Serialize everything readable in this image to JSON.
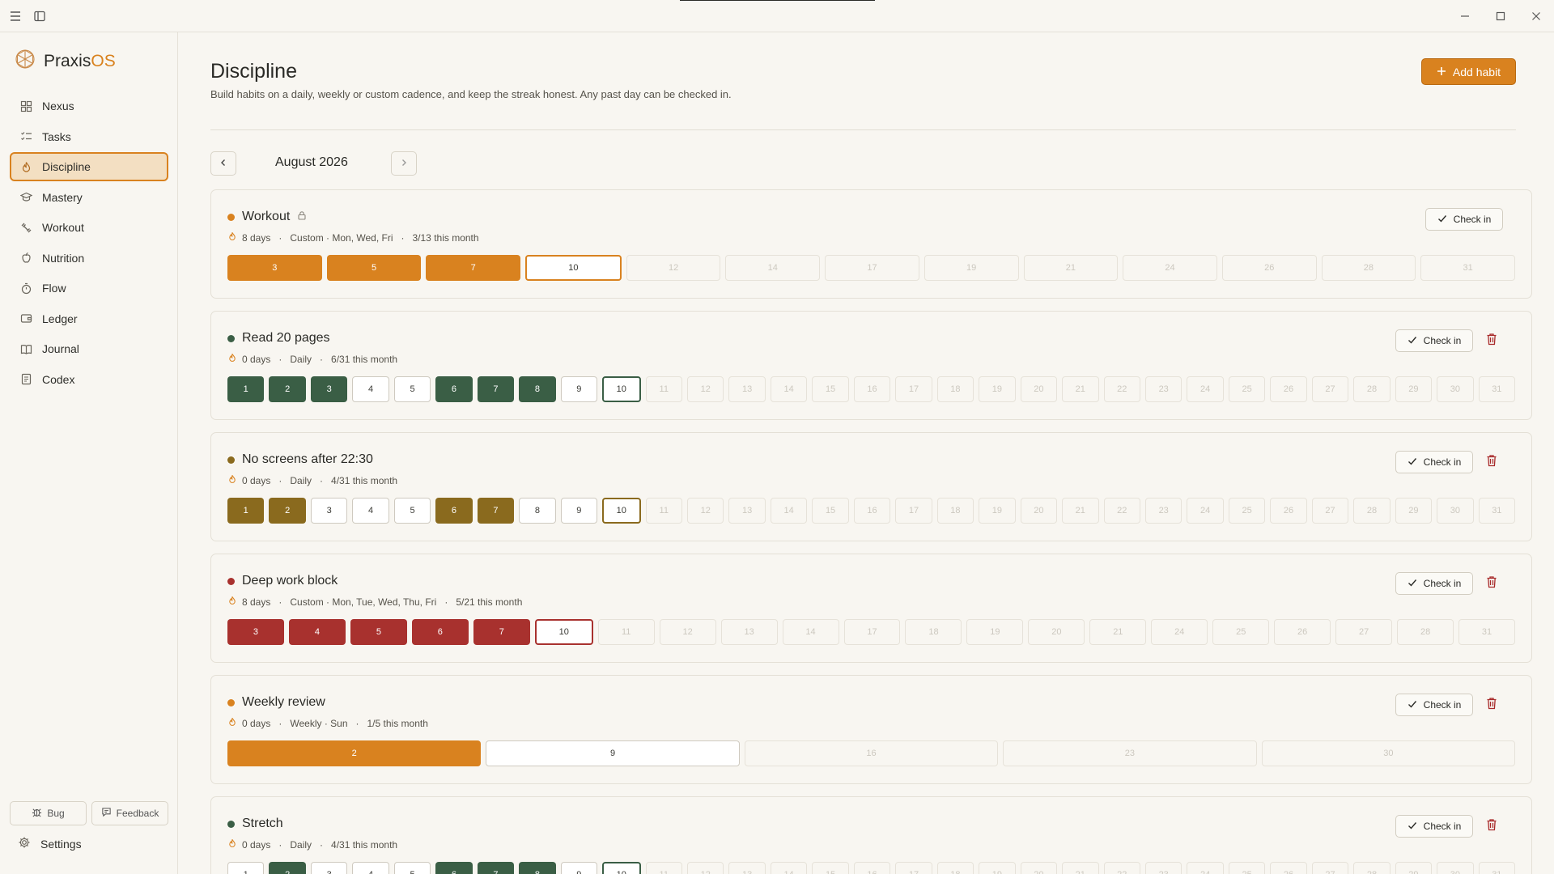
{
  "app": {
    "brand_main": "Praxis",
    "brand_accent": "OS",
    "accent_color": "#d9821f"
  },
  "sidebar": {
    "items": [
      {
        "label": "Nexus",
        "icon": "grid-icon",
        "active": false
      },
      {
        "label": "Tasks",
        "icon": "list-check-icon",
        "active": false
      },
      {
        "label": "Discipline",
        "icon": "flame-icon",
        "active": true
      },
      {
        "label": "Mastery",
        "icon": "graduation-cap-icon",
        "active": false
      },
      {
        "label": "Workout",
        "icon": "dumbbell-icon",
        "active": false
      },
      {
        "label": "Nutrition",
        "icon": "apple-icon",
        "active": false
      },
      {
        "label": "Flow",
        "icon": "timer-icon",
        "active": false
      },
      {
        "label": "Ledger",
        "icon": "wallet-icon",
        "active": false
      },
      {
        "label": "Journal",
        "icon": "book-icon",
        "active": false
      },
      {
        "label": "Codex",
        "icon": "scroll-icon",
        "active": false
      }
    ],
    "bug_label": "Bug",
    "feedback_label": "Feedback",
    "settings_label": "Settings"
  },
  "page": {
    "title": "Discipline",
    "description": "Build habits on a daily, weekly or custom cadence, and keep the streak honest. Any past day can be checked in.",
    "add_habit_label": "Add habit",
    "month_label": "August 2026"
  },
  "check_in_label": "Check in",
  "habits": [
    {
      "name": "Workout",
      "color": "#d9821f",
      "locked": true,
      "deletable": false,
      "streak": "8 days",
      "cadence": "Custom · Mon, Wed, Fri",
      "progress": "3/13 this month",
      "days": [
        {
          "n": "3",
          "s": "done"
        },
        {
          "n": "5",
          "s": "done"
        },
        {
          "n": "7",
          "s": "done"
        },
        {
          "n": "10",
          "s": "today"
        },
        {
          "n": "12",
          "s": "future"
        },
        {
          "n": "14",
          "s": "future"
        },
        {
          "n": "17",
          "s": "future"
        },
        {
          "n": "19",
          "s": "future"
        },
        {
          "n": "21",
          "s": "future"
        },
        {
          "n": "24",
          "s": "future"
        },
        {
          "n": "26",
          "s": "future"
        },
        {
          "n": "28",
          "s": "future"
        },
        {
          "n": "31",
          "s": "future"
        }
      ]
    },
    {
      "name": "Read 20 pages",
      "color": "#3a5e45",
      "locked": false,
      "deletable": true,
      "streak": "0 days",
      "cadence": "Daily",
      "progress": "6/31 this month",
      "days": [
        {
          "n": "1",
          "s": "done"
        },
        {
          "n": "2",
          "s": "done"
        },
        {
          "n": "3",
          "s": "done"
        },
        {
          "n": "4",
          "s": "past"
        },
        {
          "n": "5",
          "s": "past"
        },
        {
          "n": "6",
          "s": "done"
        },
        {
          "n": "7",
          "s": "done"
        },
        {
          "n": "8",
          "s": "done"
        },
        {
          "n": "9",
          "s": "past"
        },
        {
          "n": "10",
          "s": "today"
        },
        {
          "n": "11",
          "s": "future"
        },
        {
          "n": "12",
          "s": "future"
        },
        {
          "n": "13",
          "s": "future"
        },
        {
          "n": "14",
          "s": "future"
        },
        {
          "n": "15",
          "s": "future"
        },
        {
          "n": "16",
          "s": "future"
        },
        {
          "n": "17",
          "s": "future"
        },
        {
          "n": "18",
          "s": "future"
        },
        {
          "n": "19",
          "s": "future"
        },
        {
          "n": "20",
          "s": "future"
        },
        {
          "n": "21",
          "s": "future"
        },
        {
          "n": "22",
          "s": "future"
        },
        {
          "n": "23",
          "s": "future"
        },
        {
          "n": "24",
          "s": "future"
        },
        {
          "n": "25",
          "s": "future"
        },
        {
          "n": "26",
          "s": "future"
        },
        {
          "n": "27",
          "s": "future"
        },
        {
          "n": "28",
          "s": "future"
        },
        {
          "n": "29",
          "s": "future"
        },
        {
          "n": "30",
          "s": "future"
        },
        {
          "n": "31",
          "s": "future"
        }
      ]
    },
    {
      "name": "No screens after 22:30",
      "color": "#8a6a1e",
      "locked": false,
      "deletable": true,
      "streak": "0 days",
      "cadence": "Daily",
      "progress": "4/31 this month",
      "days": [
        {
          "n": "1",
          "s": "done"
        },
        {
          "n": "2",
          "s": "done"
        },
        {
          "n": "3",
          "s": "past"
        },
        {
          "n": "4",
          "s": "past"
        },
        {
          "n": "5",
          "s": "past"
        },
        {
          "n": "6",
          "s": "done"
        },
        {
          "n": "7",
          "s": "done"
        },
        {
          "n": "8",
          "s": "past"
        },
        {
          "n": "9",
          "s": "past"
        },
        {
          "n": "10",
          "s": "today"
        },
        {
          "n": "11",
          "s": "future"
        },
        {
          "n": "12",
          "s": "future"
        },
        {
          "n": "13",
          "s": "future"
        },
        {
          "n": "14",
          "s": "future"
        },
        {
          "n": "15",
          "s": "future"
        },
        {
          "n": "16",
          "s": "future"
        },
        {
          "n": "17",
          "s": "future"
        },
        {
          "n": "18",
          "s": "future"
        },
        {
          "n": "19",
          "s": "future"
        },
        {
          "n": "20",
          "s": "future"
        },
        {
          "n": "21",
          "s": "future"
        },
        {
          "n": "22",
          "s": "future"
        },
        {
          "n": "23",
          "s": "future"
        },
        {
          "n": "24",
          "s": "future"
        },
        {
          "n": "25",
          "s": "future"
        },
        {
          "n": "26",
          "s": "future"
        },
        {
          "n": "27",
          "s": "future"
        },
        {
          "n": "28",
          "s": "future"
        },
        {
          "n": "29",
          "s": "future"
        },
        {
          "n": "30",
          "s": "future"
        },
        {
          "n": "31",
          "s": "future"
        }
      ]
    },
    {
      "name": "Deep work block",
      "color": "#a8312e",
      "locked": false,
      "deletable": true,
      "streak": "8 days",
      "cadence": "Custom · Mon, Tue, Wed, Thu, Fri",
      "progress": "5/21 this month",
      "days": [
        {
          "n": "3",
          "s": "done"
        },
        {
          "n": "4",
          "s": "done"
        },
        {
          "n": "5",
          "s": "done"
        },
        {
          "n": "6",
          "s": "done"
        },
        {
          "n": "7",
          "s": "done"
        },
        {
          "n": "10",
          "s": "today"
        },
        {
          "n": "11",
          "s": "future"
        },
        {
          "n": "12",
          "s": "future"
        },
        {
          "n": "13",
          "s": "future"
        },
        {
          "n": "14",
          "s": "future"
        },
        {
          "n": "17",
          "s": "future"
        },
        {
          "n": "18",
          "s": "future"
        },
        {
          "n": "19",
          "s": "future"
        },
        {
          "n": "20",
          "s": "future"
        },
        {
          "n": "21",
          "s": "future"
        },
        {
          "n": "24",
          "s": "future"
        },
        {
          "n": "25",
          "s": "future"
        },
        {
          "n": "26",
          "s": "future"
        },
        {
          "n": "27",
          "s": "future"
        },
        {
          "n": "28",
          "s": "future"
        },
        {
          "n": "31",
          "s": "future"
        }
      ]
    },
    {
      "name": "Weekly review",
      "color": "#d9821f",
      "locked": false,
      "deletable": true,
      "streak": "0 days",
      "cadence": "Weekly · Sun",
      "progress": "1/5 this month",
      "days": [
        {
          "n": "2",
          "s": "done"
        },
        {
          "n": "9",
          "s": "past"
        },
        {
          "n": "16",
          "s": "future"
        },
        {
          "n": "23",
          "s": "future"
        },
        {
          "n": "30",
          "s": "future"
        }
      ]
    },
    {
      "name": "Stretch",
      "color": "#3a5e45",
      "locked": false,
      "deletable": true,
      "streak": "0 days",
      "cadence": "Daily",
      "progress": "4/31 this month",
      "days": [
        {
          "n": "1",
          "s": "past"
        },
        {
          "n": "2",
          "s": "done"
        },
        {
          "n": "3",
          "s": "past"
        },
        {
          "n": "4",
          "s": "past"
        },
        {
          "n": "5",
          "s": "past"
        },
        {
          "n": "6",
          "s": "done"
        },
        {
          "n": "7",
          "s": "done"
        },
        {
          "n": "8",
          "s": "done"
        },
        {
          "n": "9",
          "s": "past"
        },
        {
          "n": "10",
          "s": "today"
        },
        {
          "n": "11",
          "s": "future"
        },
        {
          "n": "12",
          "s": "future"
        },
        {
          "n": "13",
          "s": "future"
        },
        {
          "n": "14",
          "s": "future"
        },
        {
          "n": "15",
          "s": "future"
        },
        {
          "n": "16",
          "s": "future"
        },
        {
          "n": "17",
          "s": "future"
        },
        {
          "n": "18",
          "s": "future"
        },
        {
          "n": "19",
          "s": "future"
        },
        {
          "n": "20",
          "s": "future"
        },
        {
          "n": "21",
          "s": "future"
        },
        {
          "n": "22",
          "s": "future"
        },
        {
          "n": "23",
          "s": "future"
        },
        {
          "n": "24",
          "s": "future"
        },
        {
          "n": "25",
          "s": "future"
        },
        {
          "n": "26",
          "s": "future"
        },
        {
          "n": "27",
          "s": "future"
        },
        {
          "n": "28",
          "s": "future"
        },
        {
          "n": "29",
          "s": "future"
        },
        {
          "n": "30",
          "s": "future"
        },
        {
          "n": "31",
          "s": "future"
        }
      ]
    }
  ]
}
